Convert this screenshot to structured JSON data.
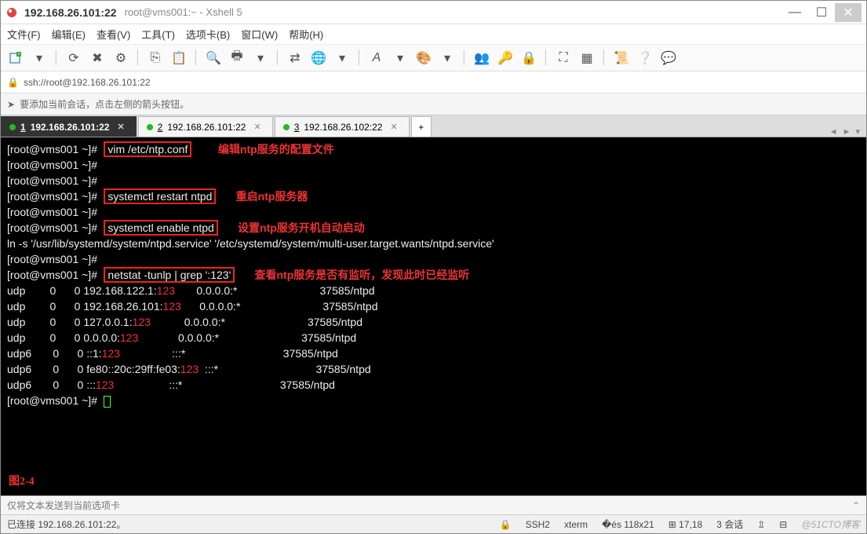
{
  "window": {
    "title_main": "192.168.26.101:22",
    "title_sub": "root@vms001:~ - Xshell 5"
  },
  "menu": {
    "file": "文件(F)",
    "edit": "编辑(E)",
    "view": "查看(V)",
    "tools": "工具(T)",
    "tabs": "选项卡(B)",
    "window": "窗口(W)",
    "help": "帮助(H)"
  },
  "address": {
    "url": "ssh://root@192.168.26.101:22"
  },
  "hint": {
    "text": "要添加当前会话，点击左侧的箭头按钮。"
  },
  "tabs": {
    "items": [
      {
        "index": "1",
        "label": "192.168.26.101:22",
        "active": true
      },
      {
        "index": "2",
        "label": "192.168.26.101:22",
        "active": false
      },
      {
        "index": "3",
        "label": "192.168.26.102:22",
        "active": false
      }
    ]
  },
  "term": {
    "prompt": "[root@vms001 ~]#",
    "cmd1": "vim /etc/ntp.conf",
    "note1": "编辑ntp服务的配置文件",
    "cmd2": "systemctl restart ntpd",
    "note2": "重启ntp服务器",
    "cmd3": "systemctl enable ntpd",
    "note3": "设置ntp服务开机自动启动",
    "enable_out": "ln -s '/usr/lib/systemd/system/ntpd.service' '/etc/systemd/system/multi-user.target.wants/ntpd.service'",
    "cmd4": "netstat -tunlp | grep ':123'",
    "note4": "查看ntp服务是否有监听，发现此时已经监听",
    "rows": [
      {
        "proto": "udp",
        "recv": "0",
        "send": "0",
        "local_pre": "192.168.122.1:",
        "port": "123",
        "foreign": "0.0.0.0:*",
        "pid": "37585/ntpd"
      },
      {
        "proto": "udp",
        "recv": "0",
        "send": "0",
        "local_pre": "192.168.26.101:",
        "port": "123",
        "foreign": "0.0.0.0:*",
        "pid": "37585/ntpd"
      },
      {
        "proto": "udp",
        "recv": "0",
        "send": "0",
        "local_pre": "127.0.0.1:",
        "port": "123",
        "foreign": "0.0.0.0:*",
        "pid": "37585/ntpd"
      },
      {
        "proto": "udp",
        "recv": "0",
        "send": "0",
        "local_pre": "0.0.0.0:",
        "port": "123",
        "foreign": "0.0.0.0:*",
        "pid": "37585/ntpd"
      },
      {
        "proto": "udp6",
        "recv": "0",
        "send": "0",
        "local_pre": "::1:",
        "port": "123",
        "foreign": ":::*",
        "pid": "37585/ntpd"
      },
      {
        "proto": "udp6",
        "recv": "0",
        "send": "0",
        "local_pre": "fe80::20c:29ff:fe03:",
        "port": "123",
        "foreign": ":::*",
        "pid": "37585/ntpd"
      },
      {
        "proto": "udp6",
        "recv": "0",
        "send": "0",
        "local_pre": ":::",
        "port": "123",
        "foreign": ":::*",
        "pid": "37585/ntpd"
      }
    ],
    "figure": "图2-4"
  },
  "sendbar": {
    "text": "仅将文本发送到当前选项卡"
  },
  "status": {
    "conn": "已连接 192.168.26.101:22。",
    "proto": "SSH2",
    "term": "xterm",
    "size": "118x21",
    "cursor": "17,18",
    "sessions": "3 会话",
    "watermark": "@51CTO博客"
  }
}
